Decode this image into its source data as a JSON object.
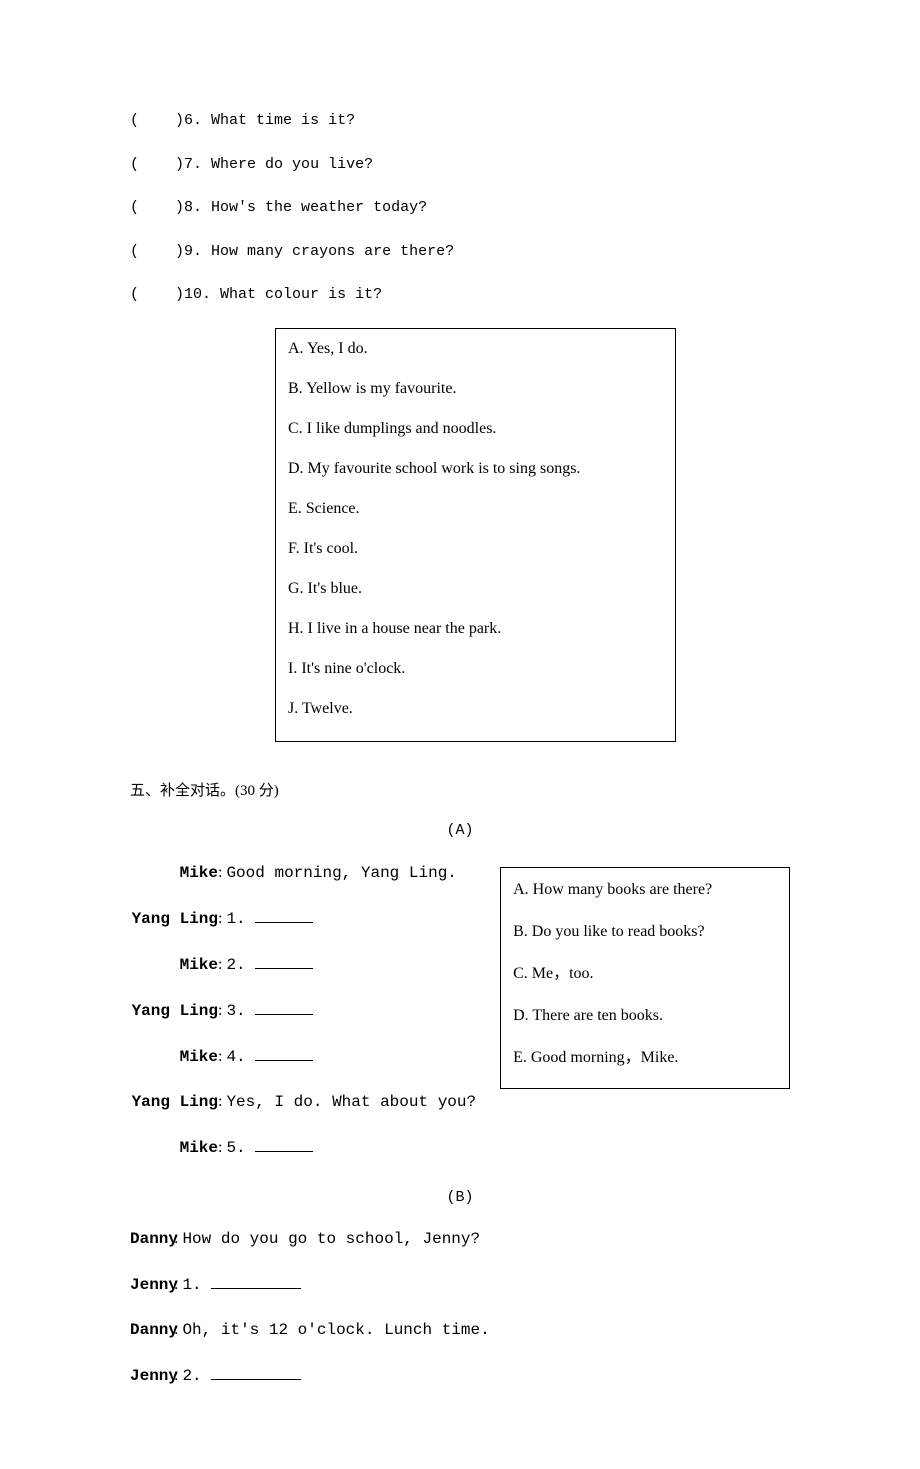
{
  "questions": [
    {
      "num": "6",
      "text": "What time is it?"
    },
    {
      "num": "7",
      "text": "Where do you live?"
    },
    {
      "num": "8",
      "text": "How's the weather today?"
    },
    {
      "num": "9",
      "text": "How many crayons are there?"
    },
    {
      "num": "10",
      "text": "What colour is it?"
    }
  ],
  "answer_box_a": [
    "A. Yes, I do.",
    "B. Yellow is my favourite.",
    "C. I like dumplings and noodles.",
    "D. My favourite school work is to sing songs.",
    "E. Science.",
    "F. It's cool.",
    "G. It's blue.",
    "H. I live in a house near the park.",
    "I. It's nine o'clock.",
    "J. Twelve."
  ],
  "section5_title": "五、补全对话。(30 分)",
  "partA_label": "(A)",
  "dialogA": [
    {
      "speaker": "Mike",
      "text": "Good morning, Yang Ling.",
      "blank": false
    },
    {
      "speaker": "Yang Ling",
      "text": "1. ",
      "blank": true
    },
    {
      "speaker": "Mike",
      "text": "2. ",
      "blank": true
    },
    {
      "speaker": "Yang Ling",
      "text": "3. ",
      "blank": true
    },
    {
      "speaker": "Mike",
      "text": "4. ",
      "blank": true
    },
    {
      "speaker": "Yang Ling",
      "text": "Yes, I do. What about you?",
      "blank": false
    },
    {
      "speaker": "Mike",
      "text": "5. ",
      "blank": true
    }
  ],
  "answer_box_b": [
    "A. How many books are there?",
    "B. Do you like to read books?",
    "C. Me，too.",
    "D. There are ten books.",
    "E. Good morning，Mike."
  ],
  "partB_label": "(B)",
  "dialogB": [
    {
      "speaker": "Danny",
      "text": "How do you go to school, Jenny?",
      "blank": false
    },
    {
      "speaker": "Jenny",
      "text": "1. ",
      "blank": true,
      "long": true
    },
    {
      "speaker": "Danny",
      "text": "Oh, it's 12 o'clock. Lunch time.",
      "blank": false
    },
    {
      "speaker": "Jenny",
      "text": "2. ",
      "blank": true,
      "long": true
    }
  ]
}
